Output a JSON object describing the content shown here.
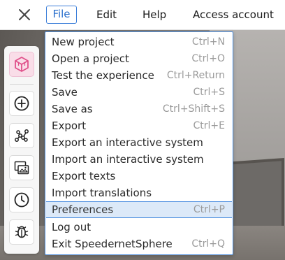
{
  "menubar": {
    "file": "File",
    "edit": "Edit",
    "help": "Help",
    "account": "Access account"
  },
  "toolbar": {
    "tools": [
      "cube-icon",
      "add-circle-icon",
      "network-nodes-icon",
      "image-gallery-icon",
      "clock-icon",
      "bug-icon"
    ],
    "active_tool": "cube-icon"
  },
  "file_menu": {
    "items": [
      {
        "label": "New project",
        "shortcut": "Ctrl+N"
      },
      {
        "label": "Open a project",
        "shortcut": "Ctrl+O"
      },
      {
        "label": "Test the experience",
        "shortcut": "Ctrl+Return"
      },
      {
        "label": "Save",
        "shortcut": "Ctrl+S"
      },
      {
        "label": "Save as",
        "shortcut": "Ctrl+Shift+S"
      },
      {
        "label": "Export",
        "shortcut": "Ctrl+E"
      },
      {
        "label": "Export an interactive system",
        "shortcut": ""
      },
      {
        "label": "Import an interactive system",
        "shortcut": ""
      },
      {
        "label": "Export texts",
        "shortcut": ""
      },
      {
        "label": "Import translations",
        "shortcut": ""
      },
      {
        "label": "Preferences",
        "shortcut": "Ctrl+P"
      },
      {
        "label": "Log out",
        "shortcut": ""
      },
      {
        "label": "Exit SpeedernetSphere",
        "shortcut": "Ctrl+Q"
      }
    ],
    "highlighted_item": "Preferences"
  },
  "colors": {
    "accent": "#3b7ed9",
    "highlight_bg": "#dce9f8",
    "active_tool_bg": "#f9dde8",
    "cube_icon": "#e0508a"
  }
}
